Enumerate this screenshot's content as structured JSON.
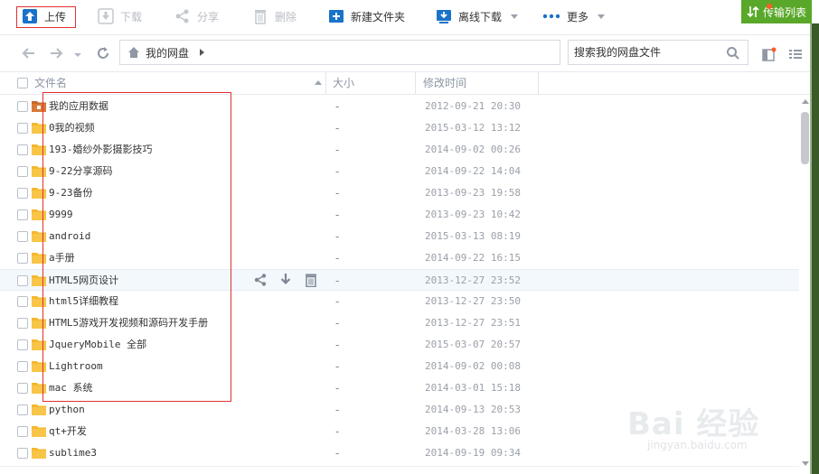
{
  "toolbar": {
    "upload": "上传",
    "download": "下载",
    "share": "分享",
    "delete": "删除",
    "new_folder": "新建文件夹",
    "offline_download": "离线下载",
    "more": "更多",
    "transfer_list": "传输列表"
  },
  "nav": {
    "breadcrumb_root": "我的网盘",
    "search_placeholder": "搜索我的网盘文件"
  },
  "columns": {
    "name": "文件名",
    "size": "大小",
    "modified": "修改时间"
  },
  "files": [
    {
      "name": "我的应用数据",
      "size": "-",
      "modified": "2012-09-21 20:30",
      "icon": "app-data-folder-icon"
    },
    {
      "name": "0我的视频",
      "size": "-",
      "modified": "2015-03-12 13:12",
      "icon": "folder-icon"
    },
    {
      "name": "193-婚纱外影摄影技巧",
      "size": "-",
      "modified": "2014-09-02 00:26",
      "icon": "folder-icon"
    },
    {
      "name": "9-22分享源码",
      "size": "-",
      "modified": "2014-09-22 14:04",
      "icon": "folder-icon"
    },
    {
      "name": "9-23备份",
      "size": "-",
      "modified": "2013-09-23 19:58",
      "icon": "folder-icon"
    },
    {
      "name": "9999",
      "size": "-",
      "modified": "2013-09-23 10:42",
      "icon": "folder-icon"
    },
    {
      "name": "android",
      "size": "-",
      "modified": "2015-03-13 08:19",
      "icon": "folder-icon"
    },
    {
      "name": "a手册",
      "size": "-",
      "modified": "2014-09-22 16:15",
      "icon": "folder-icon"
    },
    {
      "name": "HTML5网页设计",
      "size": "-",
      "modified": "2013-12-27 23:52",
      "icon": "folder-icon"
    },
    {
      "name": "html5详细教程",
      "size": "-",
      "modified": "2013-12-27 23:50",
      "icon": "folder-icon"
    },
    {
      "name": "HTML5游戏开发视频和源码开发手册",
      "size": "-",
      "modified": "2013-12-27 23:51",
      "icon": "folder-icon"
    },
    {
      "name": "JqueryMobile 全部",
      "size": "-",
      "modified": "2015-03-07 20:57",
      "icon": "folder-icon"
    },
    {
      "name": "Lightroom",
      "size": "-",
      "modified": "2014-09-02 00:08",
      "icon": "folder-icon"
    },
    {
      "name": "mac 系统",
      "size": "-",
      "modified": "2014-03-01 15:18",
      "icon": "folder-icon"
    },
    {
      "name": "python",
      "size": "-",
      "modified": "2014-09-13 20:53",
      "icon": "folder-icon"
    },
    {
      "name": "qt+开发",
      "size": "-",
      "modified": "2014-03-28 13:06",
      "icon": "folder-icon"
    },
    {
      "name": "sublime3",
      "size": "-",
      "modified": "2014-09-19 09:34",
      "icon": "folder-icon"
    }
  ],
  "hover_row_index": 8,
  "colors": {
    "accent_blue": "#1a73c8",
    "folder_yellow": "#f5b730",
    "annotation_red": "#e03131",
    "transfer_green": "#5aa82a"
  },
  "watermark": {
    "brand": "Bai 经验",
    "url": "jingyan.baidu.com"
  }
}
